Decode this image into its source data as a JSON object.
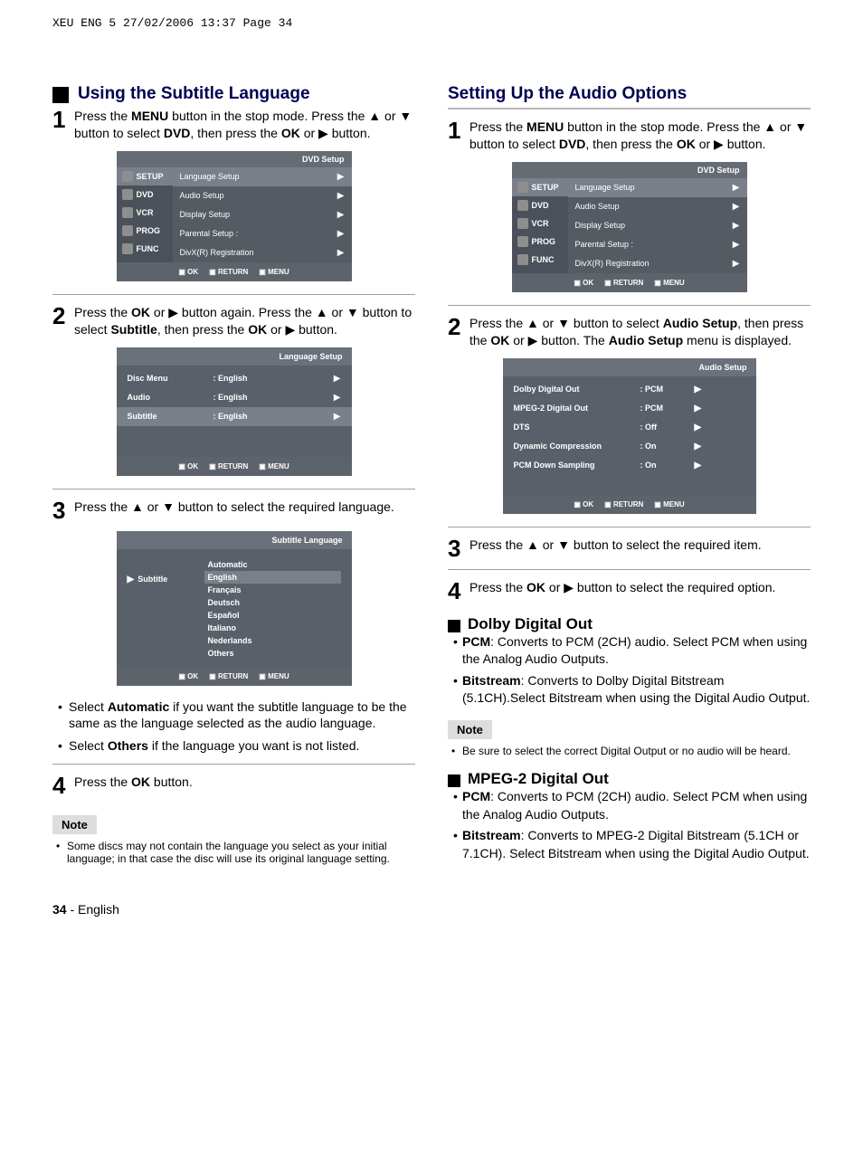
{
  "print_header": "XEU ENG 5  27/02/2006  13:37  Page 34",
  "left": {
    "title": "Using the Subtitle Language",
    "step1_a": "Press the ",
    "step1_btn1": "MENU",
    "step1_b": " button in the stop mode. Press the ▲ or ▼ button to select ",
    "step1_btn2": "DVD",
    "step1_c": ", then press the ",
    "step1_btn3": "OK",
    "step1_d": " or ▶ button.",
    "menu1": {
      "title": "DVD  Setup",
      "side": [
        "SETUP",
        "DVD",
        "VCR",
        "PROG",
        "FUNC"
      ],
      "items": [
        "Language Setup",
        "Audio Setup",
        "Display Setup",
        "Parental Setup :",
        "DivX(R) Registration"
      ],
      "footer": [
        "OK",
        "RETURN",
        "MENU"
      ]
    },
    "step2_a": "Press the ",
    "step2_b": "OK",
    "step2_c": " or ▶ button again. Press the ▲ or ▼ button to select ",
    "step2_d": "Subtitle",
    "step2_e": ", then press the ",
    "step2_f": "OK",
    "step2_g": " or ▶ button.",
    "menu2": {
      "title": "Language Setup",
      "rows": [
        {
          "label": "Disc Menu",
          "value": ": English"
        },
        {
          "label": "Audio",
          "value": ": English"
        },
        {
          "label": "Subtitle",
          "value": ": English"
        }
      ],
      "footer": [
        "OK",
        "RETURN",
        "MENU"
      ]
    },
    "step3": "Press the ▲ or ▼ button to select the required language.",
    "menu3": {
      "title": "Subtitle Language",
      "label": "Subtitle",
      "items": [
        "Automatic",
        "English",
        "Français",
        "Deutsch",
        "Español",
        "Italiano",
        "Nederlands",
        "Others"
      ],
      "footer": [
        "OK",
        "RETURN",
        "MENU"
      ]
    },
    "bul1_a": "Select ",
    "bul1_b": "Automatic",
    "bul1_c": " if you want the subtitle language to be the same as the language selected as the audio language.",
    "bul2_a": "Select ",
    "bul2_b": "Others",
    "bul2_c": " if the language you want is not listed.",
    "step4_a": "Press the ",
    "step4_b": "OK",
    "step4_c": " button.",
    "note_label": "Note",
    "note_text": "Some discs may not contain the language you select as your initial language; in that case the disc will use its original language setting."
  },
  "right": {
    "title": "Setting Up the Audio Options",
    "step1_a": "Press the ",
    "step1_btn1": "MENU",
    "step1_b": " button in the stop mode. Press the ▲ or ▼ button to select ",
    "step1_btn2": "DVD",
    "step1_c": ", then press the ",
    "step1_btn3": "OK",
    "step1_d": " or ▶ button.",
    "menu1": {
      "title": "DVD  Setup",
      "side": [
        "SETUP",
        "DVD",
        "VCR",
        "PROG",
        "FUNC"
      ],
      "items": [
        "Language Setup",
        "Audio Setup",
        "Display Setup",
        "Parental Setup :",
        "DivX(R) Registration"
      ],
      "footer": [
        "OK",
        "RETURN",
        "MENU"
      ]
    },
    "step2_a": "Press the ▲ or ▼ button to select ",
    "step2_b": "Audio Setup",
    "step2_c": ", then press the ",
    "step2_d": "OK",
    "step2_e": " or ▶ button. The ",
    "step2_f": "Audio Setup",
    "step2_g": " menu is displayed.",
    "menu2": {
      "title": "Audio Setup",
      "rows": [
        {
          "label": "Dolby Digital Out",
          "value": ": PCM"
        },
        {
          "label": "MPEG-2 Digital Out",
          "value": ": PCM"
        },
        {
          "label": "DTS",
          "value": ": Off"
        },
        {
          "label": "Dynamic Compression",
          "value": ": On"
        },
        {
          "label": "PCM Down Sampling",
          "value": ": On"
        }
      ],
      "footer": [
        "OK",
        "RETURN",
        "MENU"
      ]
    },
    "step3": "Press the ▲ or ▼ button to select the required item.",
    "step4_a": "Press the ",
    "step4_b": "OK",
    "step4_c": " or ▶ button to select the required option.",
    "sec1_title": "Dolby Digital Out",
    "sec1_pcm_label": "PCM",
    "sec1_pcm": ": Converts to PCM (2CH) audio. Select PCM when using the Analog Audio Outputs.",
    "sec1_bit_label": "Bitstream",
    "sec1_bit": ":  Converts to Dolby Digital Bitstream (5.1CH).Select Bitstream when using the Digital Audio Output.",
    "note_label": "Note",
    "note_text": "Be sure to select the correct Digital Output or no audio will be heard.",
    "sec2_title": "MPEG-2 Digital Out",
    "sec2_pcm_label": "PCM",
    "sec2_pcm": ": Converts to PCM (2CH) audio. Select PCM when using the Analog Audio Outputs.",
    "sec2_bit_label": "Bitstream",
    "sec2_bit": ":  Converts to MPEG-2 Digital Bitstream (5.1CH or 7.1CH). Select Bitstream when using the Digital Audio Output."
  },
  "footer": {
    "pagenum": "34",
    "dash": " -  ",
    "lang": "English"
  }
}
